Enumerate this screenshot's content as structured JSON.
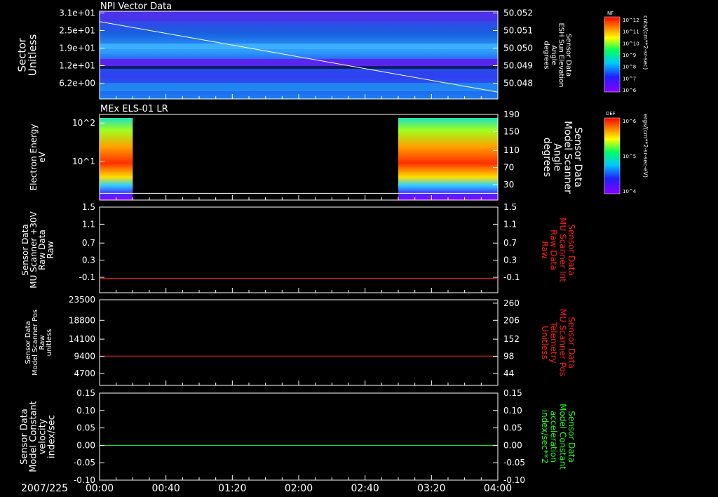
{
  "date_label": "2007/225",
  "time_ticks": [
    "00:00",
    "00:40",
    "01:20",
    "02:00",
    "02:40",
    "03:20",
    "04:00"
  ],
  "colors": {
    "red": "#ff2020",
    "green": "#20ff20",
    "white": "#ffffff"
  },
  "panels": [
    {
      "id": "npi",
      "title": "NPI Vector Data",
      "left_label": [
        "Sector",
        "Unitless"
      ],
      "left_ticks": [
        "3.1e+01",
        "2.5e+01",
        "1.9e+01",
        "1.2e+01",
        "6.2e+00"
      ],
      "right_label": [
        "Sensor Data",
        "ESH Sun Elevation",
        "Angle",
        "degrees"
      ],
      "right_ticks": [
        "50.052",
        "50.051",
        "50.050",
        "50.049",
        "50.048"
      ],
      "colorbar": {
        "title": "NF",
        "ticks": [
          "10^12",
          "10^11",
          "10^10",
          "10^9",
          "10^8",
          "10^7",
          "10^6"
        ],
        "unit": "cnts/(cm**2-sr-sec)"
      }
    },
    {
      "id": "els",
      "title": "MEx ELS-01 LR",
      "left_label": [
        "Electron Energy",
        "eV"
      ],
      "left_ticks": [
        "10^2",
        "10^1"
      ],
      "right_label": [
        "Sensor Data",
        "Model Scanner",
        "Angle",
        "degrees"
      ],
      "right_ticks": [
        "190",
        "150",
        "110",
        "70",
        "30"
      ],
      "colorbar": {
        "title": "DEF",
        "ticks": [
          "10^6",
          "10^5",
          "10^4"
        ],
        "unit": "ergs/(cm**2-sr-sec-eV)"
      }
    },
    {
      "id": "raw",
      "left_label": [
        "Sensor Data",
        "MU Scanner +30V",
        "Raw Data",
        "Raw"
      ],
      "left_ticks": [
        "1.5",
        "1.1",
        "0.7",
        "0.3",
        "-0.1"
      ],
      "right_label": [
        "Sensor Data",
        "MU Scanner Int",
        "Raw Data",
        "Raw"
      ],
      "right_ticks": [
        "1.5",
        "1.1",
        "0.7",
        "0.3",
        "-0.1"
      ]
    },
    {
      "id": "pos",
      "left_label": [
        "Sensor Data",
        "Model Scanner Pos",
        "Raw",
        "unitless"
      ],
      "left_ticks": [
        "23500",
        "18800",
        "14100",
        "9400",
        "4700"
      ],
      "right_label": [
        "Sensor Data",
        "MU Scanner Pos",
        "Telemetry",
        "Unitless"
      ],
      "right_ticks": [
        "260",
        "206",
        "152",
        "98",
        "44"
      ]
    },
    {
      "id": "vel",
      "left_label": [
        "Sensor Data",
        "Model Constant",
        "velocity",
        "index/sec"
      ],
      "left_ticks": [
        "0.15",
        "0.10",
        "0.05",
        "0.00",
        "-0.05",
        "-0.10"
      ],
      "right_label": [
        "Sensor Data",
        "Model Constant",
        "acceleration",
        "index/sec**2"
      ],
      "right_ticks": [
        "0.15",
        "0.10",
        "0.05",
        "0.00",
        "-0.05",
        "-0.10"
      ]
    }
  ],
  "chart_data": [
    {
      "type": "heatmap",
      "title": "NPI Vector Data",
      "x_range": [
        "00:00",
        "04:00"
      ],
      "ylabel": "Sector Unitless",
      "y2label": "Sensor Data ESH Sun Elevation Angle degrees",
      "y2_range": [
        50.0474,
        50.0525
      ],
      "overlay_line": {
        "x": [
          "00:00",
          "04:00"
        ],
        "y2": [
          50.0519,
          50.0478
        ]
      },
      "colorbar_label": "NF cnts/(cm**2-sr-sec)"
    },
    {
      "type": "heatmap",
      "title": "MEx ELS-01 LR",
      "x_range": [
        "00:00",
        "04:00"
      ],
      "ylabel": "Electron Energy eV",
      "y_scale": "log",
      "data_intervals": [
        [
          "00:00",
          "00:20"
        ],
        [
          "03:00",
          "04:00"
        ]
      ],
      "high_flux_energy_range_eV": [
        10,
        100
      ],
      "y2label": "Sensor Data Model Scanner Angle degrees",
      "y2_range": [
        0,
        190
      ],
      "overlay_line": {
        "x": [
          "00:00",
          "04:00"
        ],
        "y2": [
          15,
          15
        ]
      },
      "colorbar_label": "DEF ergs/(cm**2-sr-sec-eV)"
    },
    {
      "type": "line",
      "x_range": [
        "00:00",
        "04:00"
      ],
      "ylim": [
        -0.3,
        1.5
      ],
      "series": [
        {
          "name": "Sensor Data MU Scanner Int Raw Data Raw",
          "x": [
            "00:00",
            "04:00"
          ],
          "y": [
            0.0,
            0.0
          ],
          "color": "#ff2020"
        }
      ]
    },
    {
      "type": "line",
      "x_range": [
        "00:00",
        "04:00"
      ],
      "ylim": [
        0,
        23500
      ],
      "y2lim": [
        0,
        260
      ],
      "series": [
        {
          "name": "Sensor Data MU Scanner Pos Telemetry Unitless",
          "x": [
            "00:00",
            "04:00"
          ],
          "y": [
            89,
            89
          ],
          "axis": "right",
          "color": "#ff2020"
        }
      ]
    },
    {
      "type": "line",
      "x_range": [
        "00:00",
        "04:00"
      ],
      "ylim": [
        -0.1,
        0.15
      ],
      "series": [
        {
          "name": "Sensor Data Model Constant acceleration index/sec**2",
          "x": [
            "00:00",
            "04:00"
          ],
          "y": [
            0.0,
            0.0
          ],
          "color": "#20ff20"
        }
      ]
    }
  ]
}
